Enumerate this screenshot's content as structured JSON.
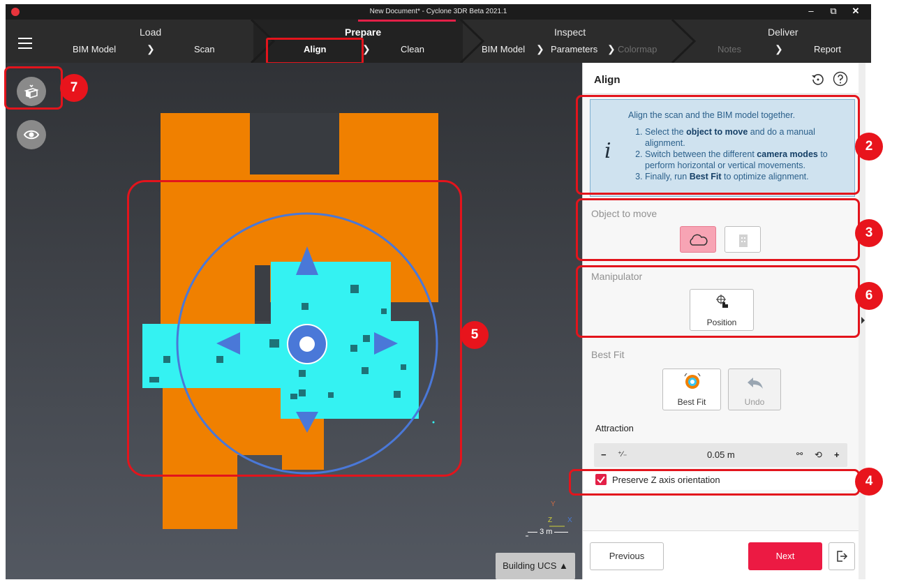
{
  "window": {
    "title": "New Document* - Cyclone 3DR Beta 2021.1",
    "controls": {
      "minimize": "–",
      "restore": "⧉",
      "close": "✕"
    }
  },
  "workflow": {
    "stages": [
      {
        "title": "Load"
      },
      {
        "title": "Prepare"
      },
      {
        "title": "Inspect"
      },
      {
        "title": "Deliver"
      }
    ],
    "steps": {
      "load_bim": "BIM Model",
      "load_scan": "Scan",
      "prepare_align": "Align",
      "prepare_clean": "Clean",
      "inspect_bim": "BIM Model",
      "inspect_params": "Parameters",
      "inspect_colormap": "Colormap",
      "deliver_notes": "Notes",
      "deliver_report": "Report"
    },
    "chevron": "❯"
  },
  "viewport": {
    "scale_label": "3 m",
    "axis": {
      "y": "Y",
      "z": "Z",
      "x": "X"
    },
    "ucs_label": "Building UCS ▲",
    "colors": {
      "bim": "#f08000",
      "scan": "#34f2f2",
      "manipulator": "#4a78d8"
    }
  },
  "annotations": [
    "7",
    "2",
    "3",
    "6",
    "5",
    "4"
  ],
  "panel": {
    "title": "Align",
    "info": {
      "lead": "Align the scan and the BIM model together.",
      "step1_pre": "Select the ",
      "step1_bold": "object to move",
      "step1_post": " and do a manual alignment.",
      "step2_pre": "Switch between the different ",
      "step2_bold": "camera modes",
      "step2_post": " to perform horizontal or vertical movements.",
      "step3_pre": "Finally, run ",
      "step3_bold": "Best Fit",
      "step3_post": " to optimize alignment.",
      "icon_glyph": "i"
    },
    "object_to_move": "Object to move",
    "manipulator": "Manipulator",
    "position_label": "Position",
    "best_fit_section": "Best Fit",
    "best_fit_label": "Best Fit",
    "undo_label": "Undo",
    "attraction_label": "Attraction",
    "attraction": {
      "minus": "−",
      "plus": "+",
      "value": "0.05 m"
    },
    "preserve_z": "Preserve Z axis orientation",
    "previous": "Previous",
    "next": "Next"
  }
}
